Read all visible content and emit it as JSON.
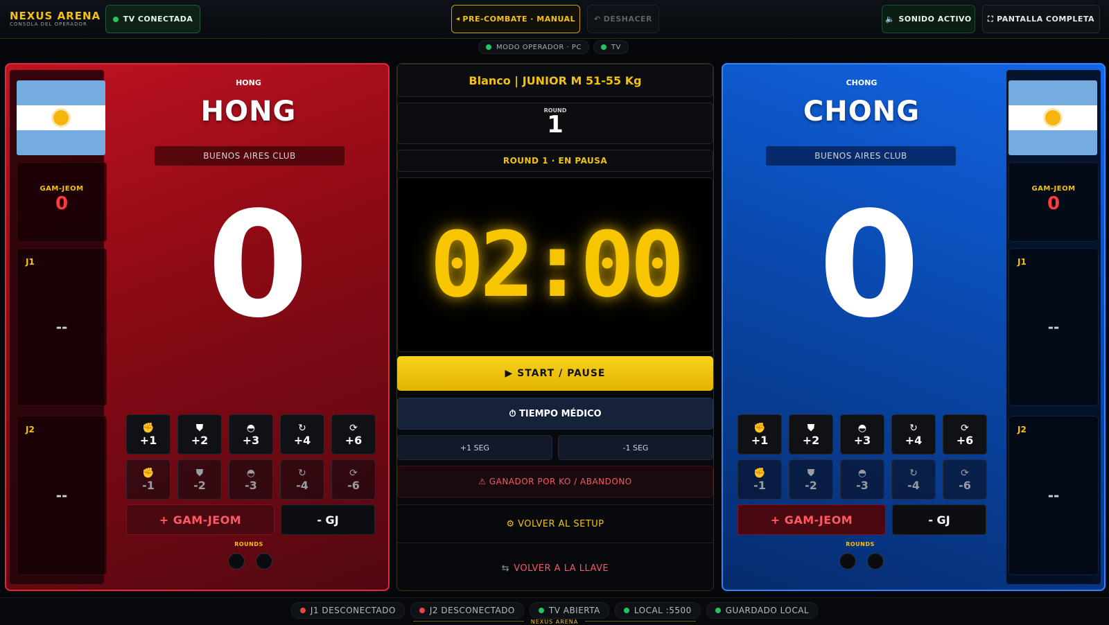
{
  "brand": {
    "title": "NEXUS ARENA",
    "subtitle": "CONSOLA DEL OPERADOR"
  },
  "top": {
    "tv_status": "TV CONECTADA",
    "mode_button": "PRE-COMBATE · MANUAL",
    "undo_button": "DESHACER",
    "sound_button": "SONIDO ACTIVO",
    "fullscreen_button": "PANTALLA COMPLETA"
  },
  "subbar": {
    "mode": "MODO OPERADOR · PC",
    "tv": "TV"
  },
  "red": {
    "corner_name": "HONG",
    "name": "HONG",
    "club": "BUENOS AIRES CLUB",
    "score": "0",
    "gam_jeom_label": "GAM-JEOM",
    "gam_jeom_value": "0",
    "j1_label": "J1",
    "j1_value": "--",
    "j2_label": "J2",
    "j2_value": "--",
    "plus": [
      "+1",
      "+2",
      "+3",
      "+4",
      "+6"
    ],
    "minus": [
      "-1",
      "-2",
      "-3",
      "-4",
      "-6"
    ],
    "gam_button": "+ GAM-JEOM",
    "gj_button": "- GJ",
    "rounds_label": "ROUNDS"
  },
  "blue": {
    "corner_name": "CHONG",
    "name": "CHONG",
    "club": "BUENOS AIRES CLUB",
    "score": "0",
    "gam_jeom_label": "GAM-JEOM",
    "gam_jeom_value": "0",
    "j1_label": "J1",
    "j1_value": "--",
    "j2_label": "J2",
    "j2_value": "--",
    "plus": [
      "+1",
      "+2",
      "+3",
      "+4",
      "+6"
    ],
    "minus": [
      "-1",
      "-2",
      "-3",
      "-4",
      "-6"
    ],
    "gam_button": "+ GAM-JEOM",
    "gj_button": "- GJ",
    "rounds_label": "ROUNDS"
  },
  "center": {
    "category": "Blanco | JUNIOR M 51-55 Kg",
    "round_label": "ROUND",
    "round_number": "1",
    "status": "ROUND 1 · EN PAUSA",
    "timer": "02:00",
    "start_button": "▶ START / PAUSE",
    "medical_button": "⏱ TIEMPO MÉDICO",
    "plus_seg": "+1 SEG",
    "minus_seg": "-1 SEG",
    "ko_button": "⚠ GANADOR POR KO / ABANDONO",
    "setup_button": "⚙ VOLVER AL SETUP",
    "llave_button": "VOLVER A LA LLAVE"
  },
  "footer": {
    "items": [
      "J1 DESCONECTADO",
      "J2 DESCONECTADO",
      "TV ABIERTA",
      "LOCAL :5500",
      "GUARDADO LOCAL"
    ],
    "brand": "NEXUS ARENA"
  },
  "colors": {
    "accent": "#f4c20d",
    "red_corner": "#c11322",
    "blue_corner": "#1366e6",
    "ok": "#22c55e",
    "error": "#ef4444"
  },
  "icons": [
    "fist-icon",
    "torso-icon",
    "head-icon",
    "spin-body-icon",
    "spin-head-icon",
    "warning-icon",
    "gear-icon",
    "return-icon",
    "timer-icon",
    "speaker-icon",
    "fullscreen-icon",
    "undo-icon"
  ]
}
